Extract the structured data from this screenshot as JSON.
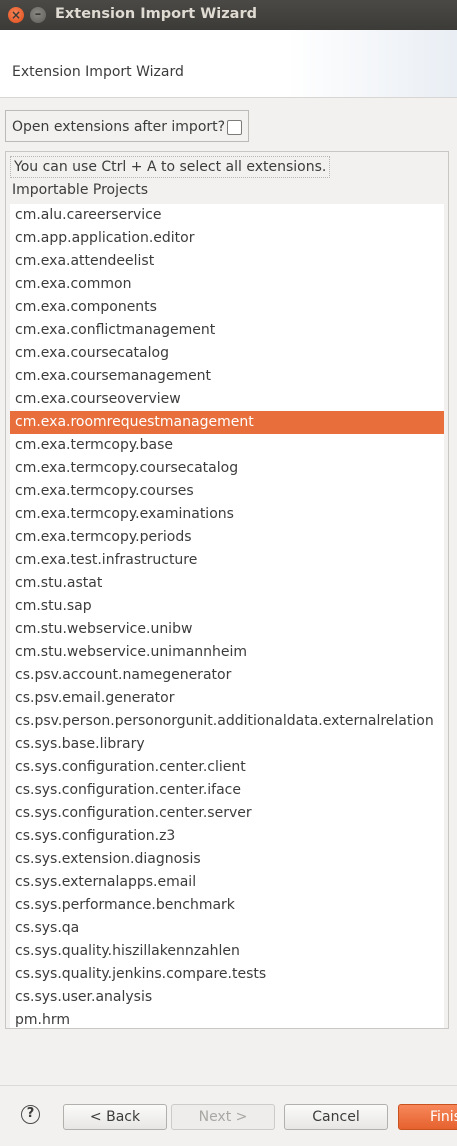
{
  "window": {
    "title": "Extension Import Wizard",
    "close_glyph": "×",
    "minimize_glyph": "–"
  },
  "header": {
    "title": "Extension Import Wizard"
  },
  "options": {
    "open_after_import_label": "Open extensions after import?",
    "open_after_import_checked": false
  },
  "hint": "You can use Ctrl + A to select all extensions.",
  "projects": {
    "label": "Importable Projects",
    "selected": "cm.exa.roomrequestmanagement",
    "items": [
      "cm.alu.careerservice",
      "cm.app.application.editor",
      "cm.exa.attendeelist",
      "cm.exa.common",
      "cm.exa.components",
      "cm.exa.conflictmanagement",
      "cm.exa.coursecatalog",
      "cm.exa.coursemanagement",
      "cm.exa.courseoverview",
      "cm.exa.roomrequestmanagement",
      "cm.exa.termcopy.base",
      "cm.exa.termcopy.coursecatalog",
      "cm.exa.termcopy.courses",
      "cm.exa.termcopy.examinations",
      "cm.exa.termcopy.periods",
      "cm.exa.test.infrastructure",
      "cm.stu.astat",
      "cm.stu.sap",
      "cm.stu.webservice.unibw",
      "cm.stu.webservice.unimannheim",
      "cs.psv.account.namegenerator",
      "cs.psv.email.generator",
      "cs.psv.person.personorgunit.additionaldata.externalrelation",
      "cs.sys.base.library",
      "cs.sys.configuration.center.client",
      "cs.sys.configuration.center.iface",
      "cs.sys.configuration.center.server",
      "cs.sys.configuration.z3",
      "cs.sys.extension.diagnosis",
      "cs.sys.externalapps.email",
      "cs.sys.performance.benchmark",
      "cs.sys.qa",
      "cs.sys.quality.hiszillakennzahlen",
      "cs.sys.quality.jenkins.compare.tests",
      "cs.sys.user.analysis",
      "pm.hrm"
    ]
  },
  "buttons": {
    "help": "?",
    "back": "< Back",
    "next": "Next >",
    "cancel": "Cancel",
    "finish": "Finish"
  },
  "colors": {
    "accent": "#e86f3c",
    "titlebar": "#3c3b37"
  }
}
